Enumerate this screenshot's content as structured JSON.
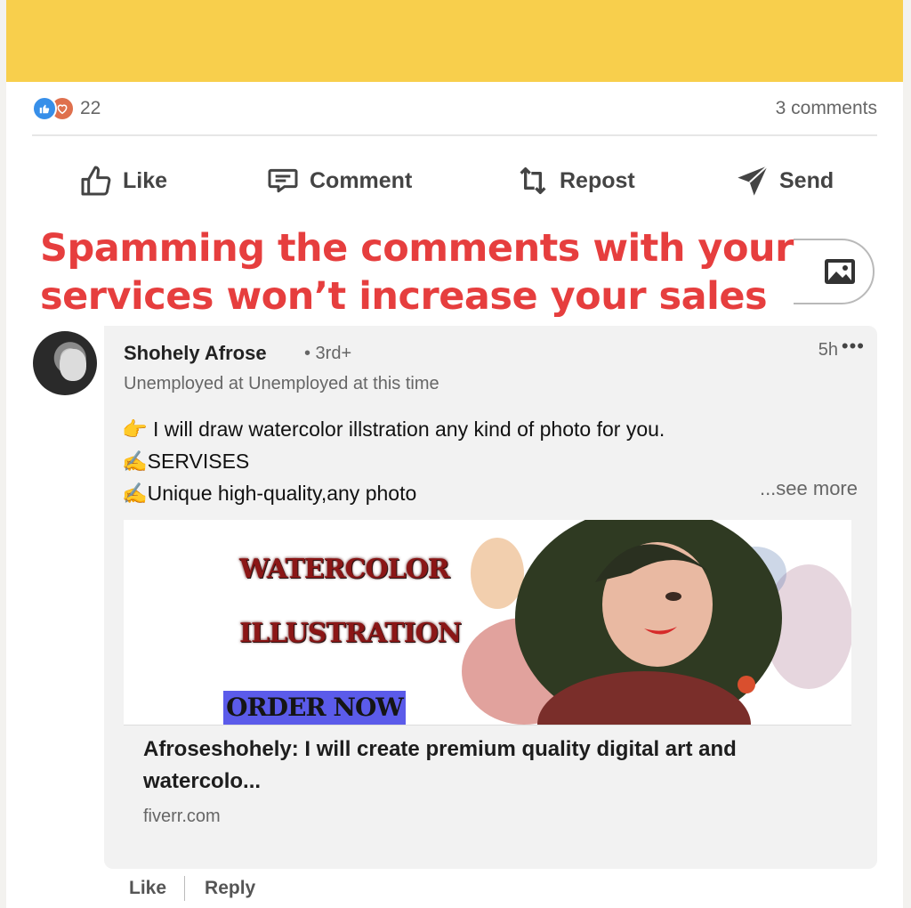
{
  "post": {
    "reaction_count": "22",
    "comments_count": "3 comments",
    "banner_color": "#f8cf4c",
    "reaction_icons": [
      "like-icon",
      "love-icon"
    ]
  },
  "actions": {
    "like": "Like",
    "comment": "Comment",
    "repost": "Repost",
    "send": "Send"
  },
  "comment_input": {
    "icon": "image-icon"
  },
  "overlay": {
    "line1": "Spamming the comments with your",
    "line2": "services won’t increase your sales",
    "color": "#e63e3e"
  },
  "comment": {
    "author": "Shohely Afrose",
    "degree": "• 3rd+",
    "headline": "Unemployed at Unemployed at this time",
    "time": "5h",
    "more": "•••",
    "lines": [
      "👉 I will draw watercolor illstration any kind of photo for you.",
      "✍️SERVISES",
      "✍️Unique high-quality,any photo"
    ],
    "see_more": "...see more",
    "preview": {
      "image_text_1": "WATERCOLOR",
      "image_text_2": "ILLUSTRATION",
      "image_button": "ORDER NOW",
      "title": "Afroseshohely: I will create premium quality digital art and watercolo...",
      "domain": "fiverr.com"
    },
    "actions": {
      "like": "Like",
      "reply": "Reply"
    }
  }
}
